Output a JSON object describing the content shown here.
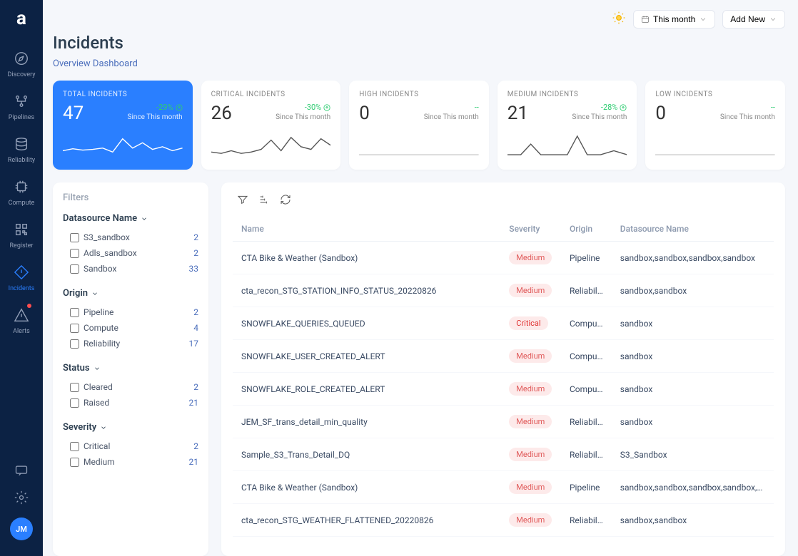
{
  "header": {
    "title": "Incidents",
    "subtitle": "Overview Dashboard"
  },
  "topbar": {
    "period_button_label": "This month",
    "add_new_label": "Add New"
  },
  "sidebar": {
    "logo_letter": "a",
    "items": [
      {
        "label": "Discovery",
        "icon": "compass-icon",
        "active": false
      },
      {
        "label": "Pipelines",
        "icon": "pipeline-icon",
        "active": false
      },
      {
        "label": "Reliability",
        "icon": "database-icon",
        "active": false
      },
      {
        "label": "Compute",
        "icon": "chip-icon",
        "active": false
      },
      {
        "label": "Register",
        "icon": "qr-icon",
        "active": false
      },
      {
        "label": "Incidents",
        "icon": "warning-diamond-icon",
        "active": true
      },
      {
        "label": "Alerts",
        "icon": "alert-triangle-icon",
        "active": false,
        "dot": true
      }
    ],
    "avatar_initials": "JM"
  },
  "kpis": [
    {
      "label": "TOTAL INCIDENTS",
      "value": "47",
      "change": "-29%",
      "since": "Since This month",
      "active": true,
      "spark": "1"
    },
    {
      "label": "CRITICAL INCIDENTS",
      "value": "26",
      "change": "-30%",
      "since": "Since This month",
      "active": false,
      "spark": "2"
    },
    {
      "label": "HIGH INCIDENTS",
      "value": "0",
      "change": "--",
      "since": "Since This month",
      "active": false,
      "spark": "flat"
    },
    {
      "label": "MEDIUM INCIDENTS",
      "value": "21",
      "change": "-28%",
      "since": "Since This month",
      "active": false,
      "spark": "3"
    },
    {
      "label": "LOW INCIDENTS",
      "value": "0",
      "change": "--",
      "since": "Since This month",
      "active": false,
      "spark": "flat"
    }
  ],
  "filters": {
    "title": "Filters",
    "groups": [
      {
        "header": "Datasource Name",
        "items": [
          {
            "label": "S3_sandbox",
            "count": "2"
          },
          {
            "label": "Adls_sandbox",
            "count": "2"
          },
          {
            "label": "Sandbox",
            "count": "33"
          }
        ]
      },
      {
        "header": "Origin",
        "items": [
          {
            "label": "Pipeline",
            "count": "2"
          },
          {
            "label": "Compute",
            "count": "4"
          },
          {
            "label": "Reliability",
            "count": "17"
          }
        ]
      },
      {
        "header": "Status",
        "items": [
          {
            "label": "Cleared",
            "count": "2"
          },
          {
            "label": "Raised",
            "count": "21"
          }
        ]
      },
      {
        "header": "Severity",
        "items": [
          {
            "label": "Critical",
            "count": "2"
          },
          {
            "label": "Medium",
            "count": "21"
          }
        ]
      }
    ]
  },
  "table": {
    "columns": [
      "Name",
      "Severity",
      "Origin",
      "Datasource Name"
    ],
    "rows": [
      {
        "name": "CTA Bike & Weather (Sandbox)",
        "severity": "Medium",
        "origin": "Pipeline",
        "datasource": "sandbox,sandbox,sandbox,sandbox"
      },
      {
        "name": "cta_recon_STG_STATION_INFO_STATUS_20220826",
        "severity": "Medium",
        "origin": "Reliability",
        "datasource": "sandbox,sandbox"
      },
      {
        "name": "SNOWFLAKE_QUERIES_QUEUED",
        "severity": "Critical",
        "origin": "Compute",
        "datasource": "sandbox"
      },
      {
        "name": "SNOWFLAKE_USER_CREATED_ALERT",
        "severity": "Medium",
        "origin": "Compute",
        "datasource": "sandbox"
      },
      {
        "name": "SNOWFLAKE_ROLE_CREATED_ALERT",
        "severity": "Medium",
        "origin": "Compute",
        "datasource": "sandbox"
      },
      {
        "name": "JEM_SF_trans_detail_min_quality",
        "severity": "Medium",
        "origin": "Reliability",
        "datasource": "sandbox"
      },
      {
        "name": "Sample_S3_Trans_Detail_DQ",
        "severity": "Medium",
        "origin": "Reliability",
        "datasource": "S3_Sandbox"
      },
      {
        "name": "CTA Bike & Weather (Sandbox)",
        "severity": "Medium",
        "origin": "Pipeline",
        "datasource": "sandbox,sandbox,sandbox,sandbox,sandbox,s"
      },
      {
        "name": "cta_recon_STG_WEATHER_FLATTENED_20220826",
        "severity": "Medium",
        "origin": "Reliability",
        "datasource": "sandbox,sandbox"
      }
    ]
  }
}
